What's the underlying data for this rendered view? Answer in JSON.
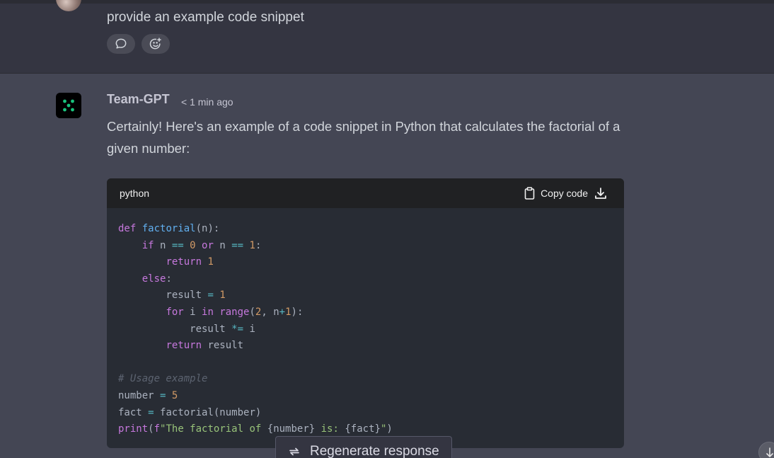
{
  "user_message": {
    "text": "provide an example code snippet",
    "reactions": [
      "comment-icon",
      "add-reaction-icon"
    ]
  },
  "assistant": {
    "name": "Team-GPT",
    "time": "< 1 min ago",
    "text": "Certainly! Here's an example of a code snippet in Python that calculates the factorial of a given number:"
  },
  "code_block": {
    "language": "python",
    "copy_label": "Copy code",
    "lines": [
      "def factorial(n):",
      "    if n == 0 or n == 1:",
      "        return 1",
      "    else:",
      "        result = 1",
      "        for i in range(2, n+1):",
      "            result *= i",
      "        return result",
      "",
      "# Usage example",
      "number = 5",
      "fact = factorial(number)",
      "print(f\"The factorial of {number} is: {fact}\")"
    ]
  },
  "footer": {
    "regenerate_label": "Regenerate response"
  },
  "colors": {
    "background": "#444654",
    "user_background": "#343541",
    "code_background": "#282c34",
    "code_header": "#202123",
    "accent_green": "#19c37d"
  }
}
